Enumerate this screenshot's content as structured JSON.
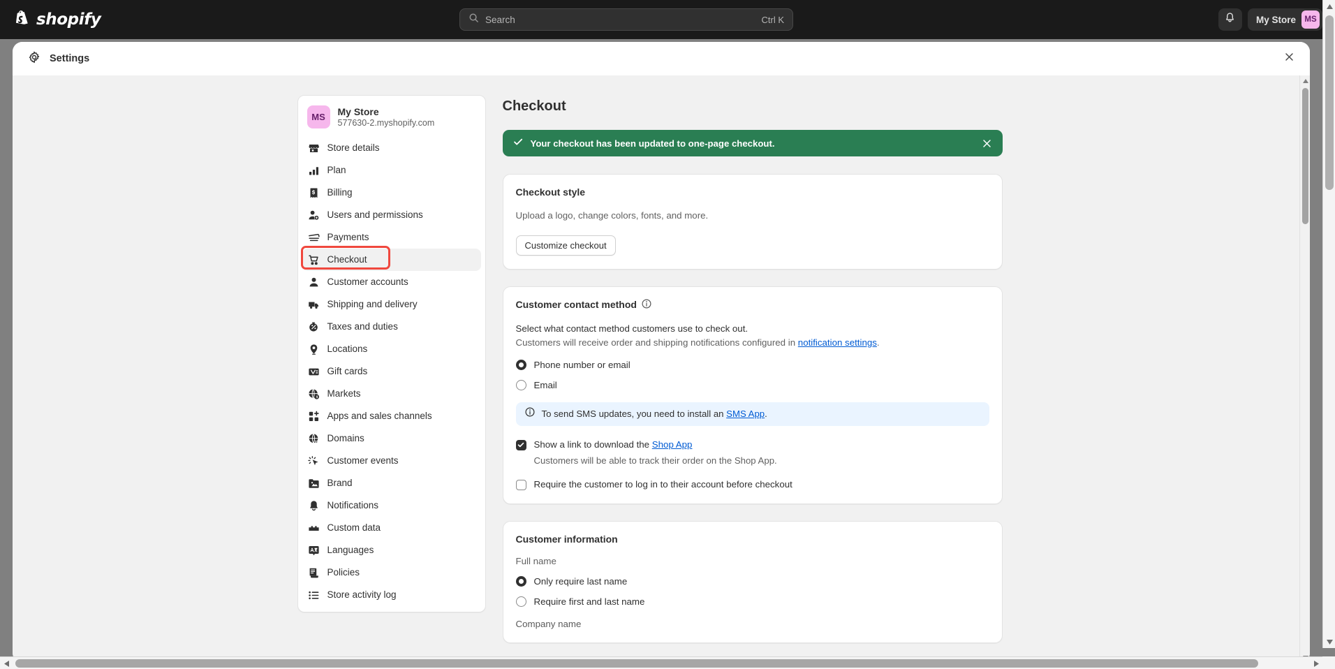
{
  "topbar": {
    "logo_text": "shopify",
    "logo_icon": "shopify-bag-icon",
    "search": {
      "icon": "search-icon",
      "placeholder": "Search",
      "shortcut": "Ctrl K"
    },
    "notifications_icon": "bell-icon",
    "store_chip": {
      "name": "My Store",
      "initials": "MS",
      "avatar_color": "#f6b7ec"
    }
  },
  "modal": {
    "icon": "gear-icon",
    "title": "Settings",
    "close_icon": "close-icon"
  },
  "sidebar": {
    "store": {
      "initials": "MS",
      "name": "My Store",
      "domain": "577630-2.myshopify.com"
    },
    "items": [
      {
        "label": "Store details",
        "icon": "store-icon",
        "selected": false
      },
      {
        "label": "Plan",
        "icon": "chart-bar-icon",
        "selected": false
      },
      {
        "label": "Billing",
        "icon": "receipt-icon",
        "selected": false
      },
      {
        "label": "Users and permissions",
        "icon": "user-add-icon",
        "selected": false
      },
      {
        "label": "Payments",
        "icon": "payment-card-icon",
        "selected": false
      },
      {
        "label": "Checkout",
        "icon": "cart-icon",
        "selected": true
      },
      {
        "label": "Customer accounts",
        "icon": "person-icon",
        "selected": false
      },
      {
        "label": "Shipping and delivery",
        "icon": "truck-icon",
        "selected": false
      },
      {
        "label": "Taxes and duties",
        "icon": "tax-icon",
        "selected": false
      },
      {
        "label": "Locations",
        "icon": "pin-icon",
        "selected": false
      },
      {
        "label": "Gift cards",
        "icon": "gift-card-icon",
        "selected": false
      },
      {
        "label": "Markets",
        "icon": "globe-money-icon",
        "selected": false
      },
      {
        "label": "Apps and sales channels",
        "icon": "apps-plus-icon",
        "selected": false
      },
      {
        "label": "Domains",
        "icon": "globe-icon",
        "selected": false
      },
      {
        "label": "Customer events",
        "icon": "cursor-click-icon",
        "selected": false
      },
      {
        "label": "Brand",
        "icon": "image-icon",
        "selected": false
      },
      {
        "label": "Notifications",
        "icon": "bell-icon",
        "selected": false
      },
      {
        "label": "Custom data",
        "icon": "blocks-icon",
        "selected": false
      },
      {
        "label": "Languages",
        "icon": "translate-icon",
        "selected": false
      },
      {
        "label": "Policies",
        "icon": "policy-icon",
        "selected": false
      },
      {
        "label": "Store activity log",
        "icon": "list-icon",
        "selected": false
      }
    ],
    "highlight": {
      "item_label": "Checkout",
      "color": "#f0483e"
    }
  },
  "main": {
    "page_title": "Checkout",
    "success_banner": {
      "icon": "check-icon",
      "text": "Your checkout has been updated to one-page checkout.",
      "close_icon": "close-icon",
      "color": "#2a7e53"
    },
    "checkout_style": {
      "title": "Checkout style",
      "description": "Upload a logo, change colors, fonts, and more.",
      "button_label": "Customize checkout"
    },
    "contact_method": {
      "title": "Customer contact method",
      "info_icon": "info-circle-icon",
      "description_line1": "Select what contact method customers use to check out.",
      "description_line2_before": "Customers will receive order and shipping notifications configured in ",
      "description_line2_link": "notification settings",
      "description_line2_after": ".",
      "options": [
        {
          "label": "Phone number or email",
          "selected": true
        },
        {
          "label": "Email",
          "selected": false
        }
      ],
      "info_banner": {
        "icon": "info-circle-icon",
        "text_before": "To send SMS updates, you need to install an ",
        "link": "SMS App",
        "text_after": ".",
        "color": "#eaf4ff"
      },
      "checkboxes": [
        {
          "checked": true,
          "label_before": "Show a link to download the ",
          "label_link": "Shop App",
          "label_after": "",
          "help": "Customers will be able to track their order on the Shop App."
        },
        {
          "checked": false,
          "label_before": "Require the customer to log in to their account before checkout",
          "label_link": "",
          "label_after": "",
          "help": ""
        }
      ]
    },
    "customer_information": {
      "title": "Customer information",
      "full_name_label": "Full name",
      "options": [
        {
          "label": "Only require last name",
          "selected": true
        },
        {
          "label": "Require first and last name",
          "selected": false
        }
      ],
      "next_field_label": "Company name"
    }
  },
  "scrollbars": {
    "inner_vertical": {
      "up_icon": "caret-up-icon",
      "down_icon": "caret-down-icon"
    },
    "page_vertical": {
      "up_icon": "caret-up-icon",
      "down_icon": "caret-down-icon"
    },
    "page_horizontal": {
      "left_icon": "caret-left-icon",
      "right_icon": "caret-right-icon"
    }
  }
}
